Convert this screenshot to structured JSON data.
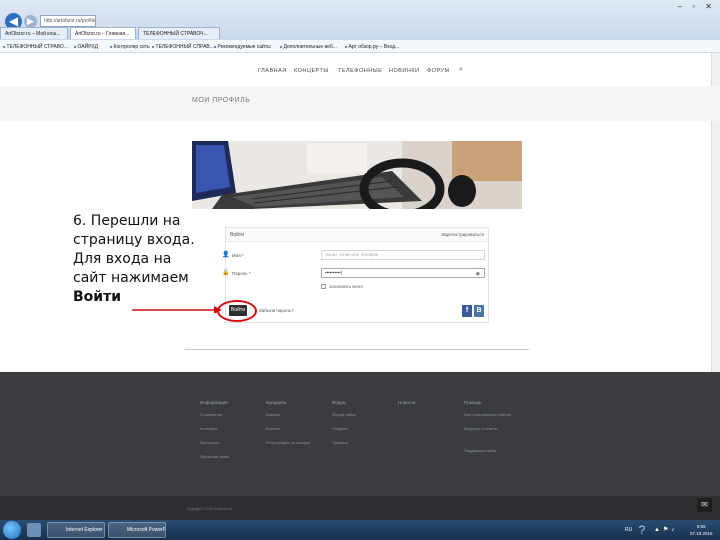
{
  "browser": {
    "url": "http://artobzor.ru/profile/",
    "tabs": [
      "ArtObzor.ru – Мой кош...",
      "ArtObzor.ru – Главная...",
      "ТЕЛЕФОННЫЙ СТРАВОЧ..."
    ],
    "window_buttons": "– ▫ ✕",
    "favorites": [
      "ТЕЛЕФОННЫЙ СТРАВО...",
      "ОАЙРХД",
      "Контролер сеть",
      "ТЕЛЕФОННЫЙ СПРАВ...",
      "Рекомендуемые сайты",
      "Дополнительные веб...",
      "Арт обзор.ру – Вход..."
    ]
  },
  "site": {
    "nav": [
      "ГЛАВНАЯ",
      "КОНЦЕРТЫ",
      "ТЕЛЕФОННЫЕ",
      "НОВИНКИ",
      "ФОРУМ"
    ],
    "page_heading": "МОИ ПРОФИЛЬ",
    "login": {
      "title": "Войти",
      "register_link": "Зарегистрироваться",
      "login_label": "Имя *",
      "login_placeholder": "логин, email или телефон",
      "password_label": "Пароль *",
      "password_value": "••••••••••|",
      "remember_label": "запомнить меня",
      "submit_label": "Войти",
      "forgot_link": "Забыли пароль?",
      "fb_label": "f",
      "vk_label": "B"
    },
    "footer": {
      "columns": [
        {
          "title": "Информация",
          "links": [
            "О компании",
            "Контакты",
            "Как купить",
            "Обратная связь"
          ]
        },
        {
          "title": "Концерты",
          "links": [
            "Афиша",
            "Билеты",
            "Регистрация на концерт"
          ]
        },
        {
          "title": "Форум",
          "links": [
            "Форум сайта",
            "Разделы",
            "Правила"
          ]
        },
        {
          "title": "Новости",
          "links": []
        },
        {
          "title": "Помощь",
          "links": [
            "Как пользоваться сайтом",
            "Вопросы и ответы",
            "Поддержка сайта"
          ]
        }
      ],
      "copyright": "Copyright © 2015 ArtObzor.ru"
    }
  },
  "annotation": {
    "lines": [
      "6. Перешли на",
      "страницу входа.",
      "Для входа на",
      "сайт нажимаем"
    ],
    "bold_line": "Войти"
  },
  "taskbar": {
    "tasks": [
      "Internet Explorer",
      "Microsoft PowerP..."
    ],
    "lang": "RU",
    "time": "9:05",
    "date": "07.10.2015"
  },
  "colors": {
    "accent_red": "#d10a0a",
    "footer_bg": "#3a3c3f",
    "fb": "#3b5998",
    "vk": "#4c75a3"
  }
}
